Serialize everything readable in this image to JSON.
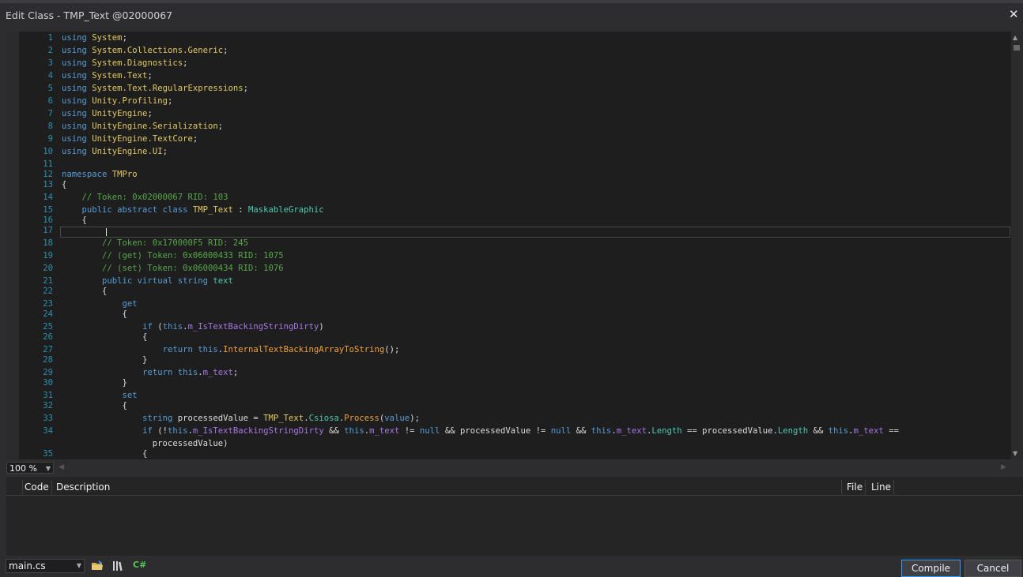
{
  "window": {
    "title": "Edit Class - TMP_Text @02000067",
    "close_glyph": "✕"
  },
  "editor": {
    "lines": [
      {
        "n": "1",
        "t": [
          [
            "kw",
            "using "
          ],
          [
            "ty",
            "System"
          ],
          [
            "p",
            ";"
          ]
        ]
      },
      {
        "n": "2",
        "t": [
          [
            "kw",
            "using "
          ],
          [
            "ty",
            "System.Collections.Generic"
          ],
          [
            "p",
            ";"
          ]
        ]
      },
      {
        "n": "3",
        "t": [
          [
            "kw",
            "using "
          ],
          [
            "ty",
            "System.Diagnostics"
          ],
          [
            "p",
            ";"
          ]
        ]
      },
      {
        "n": "4",
        "t": [
          [
            "kw",
            "using "
          ],
          [
            "ty",
            "System.Text"
          ],
          [
            "p",
            ";"
          ]
        ]
      },
      {
        "n": "5",
        "t": [
          [
            "kw",
            "using "
          ],
          [
            "ty",
            "System.Text.RegularExpressions"
          ],
          [
            "p",
            ";"
          ]
        ]
      },
      {
        "n": "6",
        "t": [
          [
            "kw",
            "using "
          ],
          [
            "ty",
            "Unity.Profiling"
          ],
          [
            "p",
            ";"
          ]
        ]
      },
      {
        "n": "7",
        "t": [
          [
            "kw",
            "using "
          ],
          [
            "ty",
            "UnityEngine"
          ],
          [
            "p",
            ";"
          ]
        ]
      },
      {
        "n": "8",
        "t": [
          [
            "kw",
            "using "
          ],
          [
            "ty",
            "UnityEngine.Serialization"
          ],
          [
            "p",
            ";"
          ]
        ]
      },
      {
        "n": "9",
        "t": [
          [
            "kw",
            "using "
          ],
          [
            "ty",
            "UnityEngine.TextCore"
          ],
          [
            "p",
            ";"
          ]
        ]
      },
      {
        "n": "10",
        "t": [
          [
            "kw",
            "using "
          ],
          [
            "ty",
            "UnityEngine.UI"
          ],
          [
            "p",
            ";"
          ]
        ]
      },
      {
        "n": "11",
        "t": []
      },
      {
        "n": "12",
        "t": [
          [
            "kw",
            "namespace "
          ],
          [
            "ty",
            "TMPro"
          ]
        ]
      },
      {
        "n": "13",
        "t": [
          [
            "p",
            "{"
          ]
        ]
      },
      {
        "n": "14",
        "t": [
          [
            "p",
            "    "
          ],
          [
            "cm",
            "// Token: 0x02000067 RID: 103"
          ]
        ]
      },
      {
        "n": "15",
        "t": [
          [
            "p",
            "    "
          ],
          [
            "kw",
            "public abstract class "
          ],
          [
            "ty",
            "TMP_Text"
          ],
          [
            "p",
            " : "
          ],
          [
            "cl",
            "MaskableGraphic"
          ]
        ]
      },
      {
        "n": "16",
        "t": [
          [
            "p",
            "    {"
          ]
        ]
      },
      {
        "n": "17",
        "t": []
      },
      {
        "n": "18",
        "t": [
          [
            "p",
            "        "
          ],
          [
            "cm",
            "// Token: 0x170000F5 RID: 245"
          ]
        ]
      },
      {
        "n": "19",
        "t": [
          [
            "p",
            "        "
          ],
          [
            "cm",
            "// (get) Token: 0x06000433 RID: 1075"
          ]
        ]
      },
      {
        "n": "20",
        "t": [
          [
            "p",
            "        "
          ],
          [
            "cm",
            "// (set) Token: 0x06000434 RID: 1076"
          ]
        ]
      },
      {
        "n": "21",
        "t": [
          [
            "p",
            "        "
          ],
          [
            "kw",
            "public virtual string "
          ],
          [
            "cl",
            "text"
          ]
        ]
      },
      {
        "n": "22",
        "t": [
          [
            "p",
            "        {"
          ]
        ]
      },
      {
        "n": "23",
        "t": [
          [
            "p",
            "            "
          ],
          [
            "kw",
            "get"
          ]
        ]
      },
      {
        "n": "24",
        "t": [
          [
            "p",
            "            {"
          ]
        ]
      },
      {
        "n": "25",
        "t": [
          [
            "p",
            "                "
          ],
          [
            "kw",
            "if "
          ],
          [
            "p",
            "("
          ],
          [
            "kw",
            "this"
          ],
          [
            "p",
            "."
          ],
          [
            "pr",
            "m_IsTextBackingStringDirty"
          ],
          [
            "p",
            ")"
          ]
        ]
      },
      {
        "n": "26",
        "t": [
          [
            "p",
            "                {"
          ]
        ]
      },
      {
        "n": "27",
        "t": [
          [
            "p",
            "                    "
          ],
          [
            "kw",
            "return this"
          ],
          [
            "p",
            "."
          ],
          [
            "me",
            "InternalTextBackingArrayToString"
          ],
          [
            "p",
            "();"
          ]
        ]
      },
      {
        "n": "28",
        "t": [
          [
            "p",
            "                }"
          ]
        ]
      },
      {
        "n": "29",
        "t": [
          [
            "p",
            "                "
          ],
          [
            "kw",
            "return this"
          ],
          [
            "p",
            "."
          ],
          [
            "pr",
            "m_text"
          ],
          [
            "p",
            ";"
          ]
        ]
      },
      {
        "n": "30",
        "t": [
          [
            "p",
            "            }"
          ]
        ]
      },
      {
        "n": "31",
        "t": [
          [
            "p",
            "            "
          ],
          [
            "kw",
            "set"
          ]
        ]
      },
      {
        "n": "32",
        "t": [
          [
            "p",
            "            {"
          ]
        ]
      },
      {
        "n": "33",
        "t": [
          [
            "p",
            "                "
          ],
          [
            "kw",
            "string "
          ],
          [
            "p",
            "processedValue = "
          ],
          [
            "ty",
            "TMP_Text"
          ],
          [
            "p",
            "."
          ],
          [
            "cl",
            "Csiosa"
          ],
          [
            "p",
            "."
          ],
          [
            "me",
            "Process"
          ],
          [
            "p",
            "("
          ],
          [
            "kw",
            "value"
          ],
          [
            "p",
            ");"
          ]
        ]
      },
      {
        "n": "34",
        "t": [
          [
            "p",
            "                "
          ],
          [
            "kw",
            "if "
          ],
          [
            "p",
            "(!"
          ],
          [
            "kw",
            "this"
          ],
          [
            "p",
            "."
          ],
          [
            "pr",
            "m_IsTextBackingStringDirty"
          ],
          [
            "p",
            " && "
          ],
          [
            "kw",
            "this"
          ],
          [
            "p",
            "."
          ],
          [
            "pr",
            "m_text"
          ],
          [
            "p",
            " != "
          ],
          [
            "kw",
            "null"
          ],
          [
            "p",
            " && processedValue != "
          ],
          [
            "kw",
            "null"
          ],
          [
            "p",
            " && "
          ],
          [
            "kw",
            "this"
          ],
          [
            "p",
            "."
          ],
          [
            "pr",
            "m_text"
          ],
          [
            "p",
            "."
          ],
          [
            "cl",
            "Length"
          ],
          [
            "p",
            " == processedValue."
          ],
          [
            "cl",
            "Length"
          ],
          [
            "p",
            " && "
          ],
          [
            "kw",
            "this"
          ],
          [
            "p",
            "."
          ],
          [
            "pr",
            "m_text"
          ],
          [
            "p",
            " =="
          ]
        ]
      },
      {
        "n": "",
        "t": [
          [
            "p",
            "                  processedValue)"
          ]
        ]
      },
      {
        "n": "35",
        "t": [
          [
            "p",
            "                {"
          ]
        ]
      }
    ]
  },
  "zoom": {
    "value": "100 %"
  },
  "error_list": {
    "columns": {
      "code": "Code",
      "description": "Description",
      "file": "File",
      "line": "Line"
    }
  },
  "bottom": {
    "file_select": "main.cs",
    "icons": [
      "open-folder-icon",
      "library-icon",
      "csharp-icon"
    ],
    "csharp_label": "C#",
    "compile_label": "Compile",
    "cancel_label": "Cancel"
  },
  "colors": {
    "keyword": "#569cd6",
    "type": "#e0c862",
    "class": "#4ec9b0",
    "comment": "#57a64a",
    "property": "#a776e6",
    "method": "#f0a040",
    "line_number": "#2b91af"
  }
}
